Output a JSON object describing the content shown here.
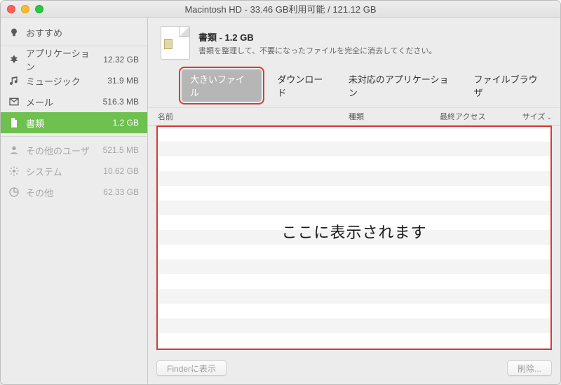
{
  "window": {
    "title": "Macintosh HD - 33.46 GB利用可能 / 121.12 GB"
  },
  "sidebar": {
    "items": [
      {
        "label": "おすすめ",
        "size": ""
      },
      {
        "label": "アプリケーション",
        "size": "12.32 GB"
      },
      {
        "label": "ミュージック",
        "size": "31.9 MB"
      },
      {
        "label": "メール",
        "size": "516.3 MB"
      },
      {
        "label": "書類",
        "size": "1.2 GB"
      },
      {
        "label": "その他のユーザ",
        "size": "521.5 MB"
      },
      {
        "label": "システム",
        "size": "10.62 GB"
      },
      {
        "label": "その他",
        "size": "62.33 GB"
      }
    ]
  },
  "header": {
    "title": "書類 - 1.2 GB",
    "subtitle": "書類を整理して、不要になったファイルを完全に消去してください。"
  },
  "tabs": [
    {
      "label": "大きいファイル"
    },
    {
      "label": "ダウンロード"
    },
    {
      "label": "未対応のアプリケーション"
    },
    {
      "label": "ファイルブラウザ"
    }
  ],
  "columns": {
    "name": "名前",
    "kind": "種類",
    "accessed": "最終アクセス",
    "size": "サイズ"
  },
  "list": {
    "placeholder": "ここに表示されます"
  },
  "footer": {
    "show_in_finder": "Finderに表示",
    "delete": "削除..."
  }
}
